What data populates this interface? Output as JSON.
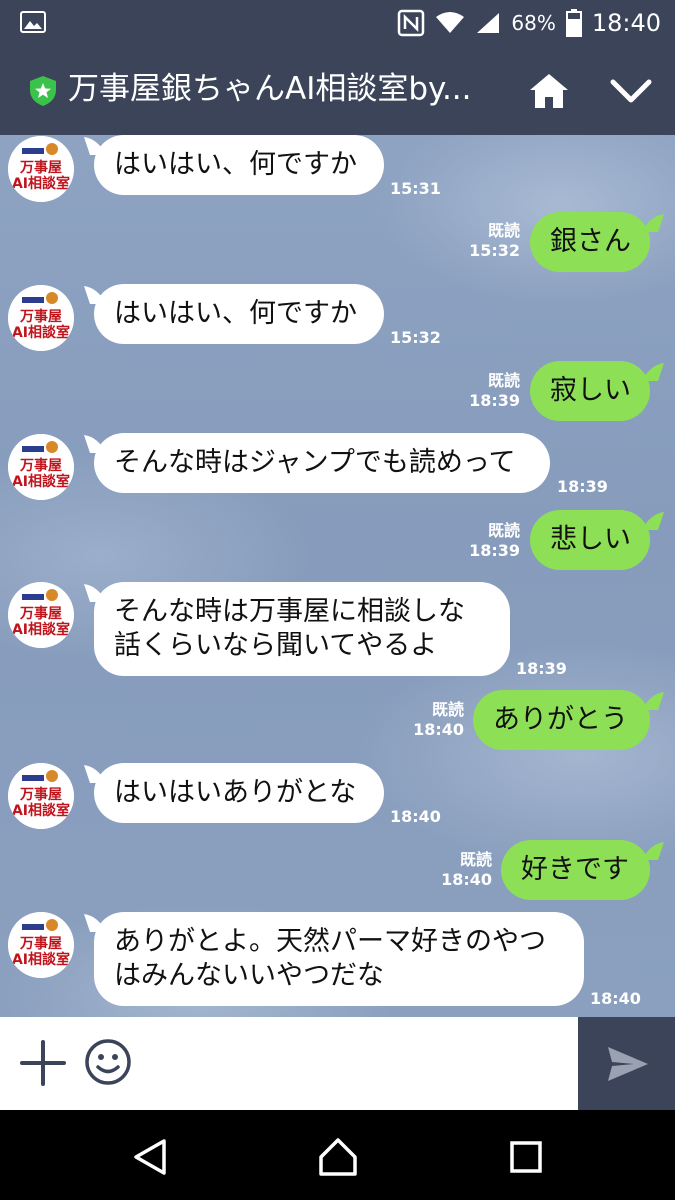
{
  "status_bar": {
    "battery": "68%",
    "time": "18:40",
    "icons": [
      "image-icon",
      "nfc-icon",
      "wifi-icon",
      "signal-icon",
      "battery-icon"
    ]
  },
  "header": {
    "title": "万事屋銀ちゃんAI相談室by...",
    "icons": [
      "verified-shield-icon",
      "home-icon",
      "chevron-down-icon"
    ],
    "background": "#3b4459"
  },
  "messages": [
    {
      "side": "in",
      "text": [
        "はいはい、何ですか"
      ],
      "time": "15:31"
    },
    {
      "side": "out",
      "text": [
        "銀さん"
      ],
      "read": "既読",
      "time": "15:32"
    },
    {
      "side": "in",
      "text": [
        "はいはい、何ですか"
      ],
      "time": "15:32"
    },
    {
      "side": "out",
      "text": [
        "寂しい"
      ],
      "read": "既読",
      "time": "18:39"
    },
    {
      "side": "in",
      "text": [
        "そんな時はジャンプでも読めって"
      ],
      "time": "18:39"
    },
    {
      "side": "out",
      "text": [
        "悲しい"
      ],
      "read": "既読",
      "time": "18:39"
    },
    {
      "side": "in",
      "text": [
        "そんな時は万事屋に相談しな",
        "話くらいなら聞いてやるよ"
      ],
      "time": "18:39"
    },
    {
      "side": "out",
      "text": [
        "ありがとう"
      ],
      "read": "既読",
      "time": "18:40"
    },
    {
      "side": "in",
      "text": [
        "はいはいありがとな"
      ],
      "time": "18:40"
    },
    {
      "side": "out",
      "text": [
        "好きです"
      ],
      "read": "既読",
      "time": "18:40"
    },
    {
      "side": "in",
      "text": [
        "ありがとよ。天然パーマ好きのやつ",
        "はみんないいやつだな"
      ],
      "time": "18:40"
    }
  ],
  "avatar_logo_text": "AI相談室",
  "input_bar": {
    "icons": [
      "plus-icon",
      "smiley-icon",
      "send-icon"
    ]
  },
  "nav_bar": {
    "icons": [
      "back-icon",
      "home-nav-icon",
      "recents-icon"
    ]
  },
  "colors": {
    "incoming_bubble": "#ffffff",
    "outgoing_bubble": "#8de055",
    "chat_background": "#8ba0bf"
  }
}
